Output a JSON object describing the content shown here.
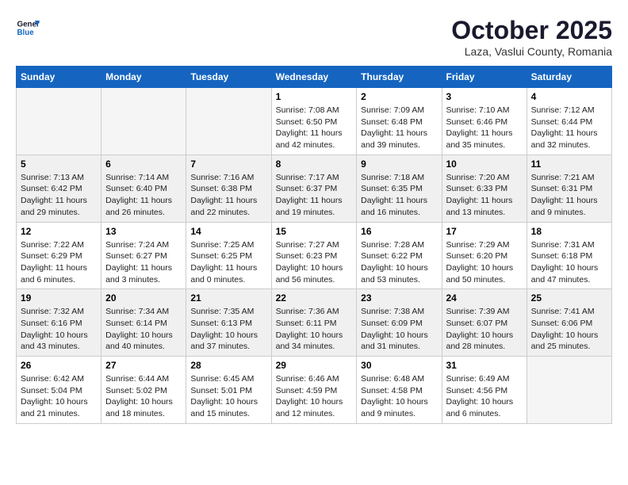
{
  "logo": {
    "general": "General",
    "blue": "Blue"
  },
  "header": {
    "month": "October 2025",
    "location": "Laza, Vaslui County, Romania"
  },
  "weekdays": [
    "Sunday",
    "Monday",
    "Tuesday",
    "Wednesday",
    "Thursday",
    "Friday",
    "Saturday"
  ],
  "weeks": [
    [
      {
        "day": "",
        "info": ""
      },
      {
        "day": "",
        "info": ""
      },
      {
        "day": "",
        "info": ""
      },
      {
        "day": "1",
        "info": "Sunrise: 7:08 AM\nSunset: 6:50 PM\nDaylight: 11 hours and 42 minutes."
      },
      {
        "day": "2",
        "info": "Sunrise: 7:09 AM\nSunset: 6:48 PM\nDaylight: 11 hours and 39 minutes."
      },
      {
        "day": "3",
        "info": "Sunrise: 7:10 AM\nSunset: 6:46 PM\nDaylight: 11 hours and 35 minutes."
      },
      {
        "day": "4",
        "info": "Sunrise: 7:12 AM\nSunset: 6:44 PM\nDaylight: 11 hours and 32 minutes."
      }
    ],
    [
      {
        "day": "5",
        "info": "Sunrise: 7:13 AM\nSunset: 6:42 PM\nDaylight: 11 hours and 29 minutes."
      },
      {
        "day": "6",
        "info": "Sunrise: 7:14 AM\nSunset: 6:40 PM\nDaylight: 11 hours and 26 minutes."
      },
      {
        "day": "7",
        "info": "Sunrise: 7:16 AM\nSunset: 6:38 PM\nDaylight: 11 hours and 22 minutes."
      },
      {
        "day": "8",
        "info": "Sunrise: 7:17 AM\nSunset: 6:37 PM\nDaylight: 11 hours and 19 minutes."
      },
      {
        "day": "9",
        "info": "Sunrise: 7:18 AM\nSunset: 6:35 PM\nDaylight: 11 hours and 16 minutes."
      },
      {
        "day": "10",
        "info": "Sunrise: 7:20 AM\nSunset: 6:33 PM\nDaylight: 11 hours and 13 minutes."
      },
      {
        "day": "11",
        "info": "Sunrise: 7:21 AM\nSunset: 6:31 PM\nDaylight: 11 hours and 9 minutes."
      }
    ],
    [
      {
        "day": "12",
        "info": "Sunrise: 7:22 AM\nSunset: 6:29 PM\nDaylight: 11 hours and 6 minutes."
      },
      {
        "day": "13",
        "info": "Sunrise: 7:24 AM\nSunset: 6:27 PM\nDaylight: 11 hours and 3 minutes."
      },
      {
        "day": "14",
        "info": "Sunrise: 7:25 AM\nSunset: 6:25 PM\nDaylight: 11 hours and 0 minutes."
      },
      {
        "day": "15",
        "info": "Sunrise: 7:27 AM\nSunset: 6:23 PM\nDaylight: 10 hours and 56 minutes."
      },
      {
        "day": "16",
        "info": "Sunrise: 7:28 AM\nSunset: 6:22 PM\nDaylight: 10 hours and 53 minutes."
      },
      {
        "day": "17",
        "info": "Sunrise: 7:29 AM\nSunset: 6:20 PM\nDaylight: 10 hours and 50 minutes."
      },
      {
        "day": "18",
        "info": "Sunrise: 7:31 AM\nSunset: 6:18 PM\nDaylight: 10 hours and 47 minutes."
      }
    ],
    [
      {
        "day": "19",
        "info": "Sunrise: 7:32 AM\nSunset: 6:16 PM\nDaylight: 10 hours and 43 minutes."
      },
      {
        "day": "20",
        "info": "Sunrise: 7:34 AM\nSunset: 6:14 PM\nDaylight: 10 hours and 40 minutes."
      },
      {
        "day": "21",
        "info": "Sunrise: 7:35 AM\nSunset: 6:13 PM\nDaylight: 10 hours and 37 minutes."
      },
      {
        "day": "22",
        "info": "Sunrise: 7:36 AM\nSunset: 6:11 PM\nDaylight: 10 hours and 34 minutes."
      },
      {
        "day": "23",
        "info": "Sunrise: 7:38 AM\nSunset: 6:09 PM\nDaylight: 10 hours and 31 minutes."
      },
      {
        "day": "24",
        "info": "Sunrise: 7:39 AM\nSunset: 6:07 PM\nDaylight: 10 hours and 28 minutes."
      },
      {
        "day": "25",
        "info": "Sunrise: 7:41 AM\nSunset: 6:06 PM\nDaylight: 10 hours and 25 minutes."
      }
    ],
    [
      {
        "day": "26",
        "info": "Sunrise: 6:42 AM\nSunset: 5:04 PM\nDaylight: 10 hours and 21 minutes."
      },
      {
        "day": "27",
        "info": "Sunrise: 6:44 AM\nSunset: 5:02 PM\nDaylight: 10 hours and 18 minutes."
      },
      {
        "day": "28",
        "info": "Sunrise: 6:45 AM\nSunset: 5:01 PM\nDaylight: 10 hours and 15 minutes."
      },
      {
        "day": "29",
        "info": "Sunrise: 6:46 AM\nSunset: 4:59 PM\nDaylight: 10 hours and 12 minutes."
      },
      {
        "day": "30",
        "info": "Sunrise: 6:48 AM\nSunset: 4:58 PM\nDaylight: 10 hours and 9 minutes."
      },
      {
        "day": "31",
        "info": "Sunrise: 6:49 AM\nSunset: 4:56 PM\nDaylight: 10 hours and 6 minutes."
      },
      {
        "day": "",
        "info": ""
      }
    ]
  ]
}
